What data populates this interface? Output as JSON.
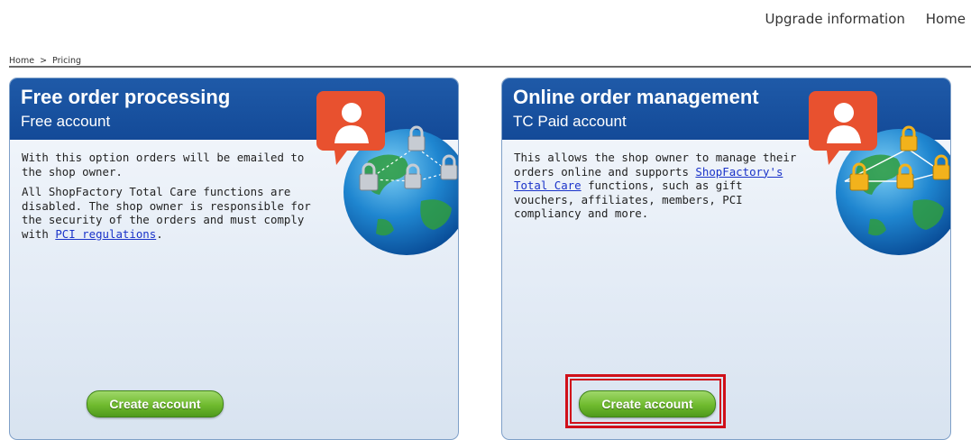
{
  "nav": {
    "upgrade": "Upgrade information",
    "home": "Home"
  },
  "breadcrumb": {
    "home": "Home",
    "separator": ">",
    "current": "Pricing"
  },
  "cards": [
    {
      "title": "Free order processing",
      "subtitle": "Free account",
      "paragraph1": "With this option orders will be emailed to the shop owner.",
      "paragraph2_pre": "All ShopFactory Total Care functions are disabled. The shop owner is responsible for the security of the orders and must comply with ",
      "paragraph2_link": "PCI regulations",
      "paragraph2_post": ".",
      "button": "Create account"
    },
    {
      "title": "Online order management",
      "subtitle": "TC Paid account",
      "paragraph1_pre": "This allows the shop owner to manage their orders online and supports ",
      "paragraph1_link": "ShopFactory's Total Care",
      "paragraph1_post": " functions, such as gift vouchers, affiliates, members, PCI compliancy and more.",
      "button": "Create account"
    }
  ],
  "colors": {
    "header_blue": "#1a52a0",
    "button_green": "#6fba2e",
    "highlight_red": "#d0101a",
    "link_blue": "#1a33c9"
  }
}
